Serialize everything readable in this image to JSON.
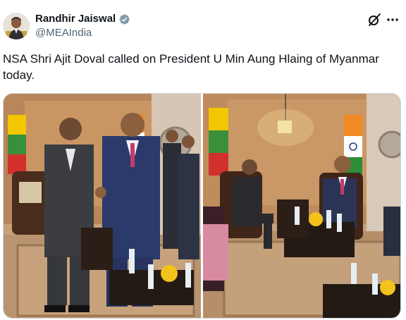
{
  "post": {
    "author": {
      "display_name": "Randhir Jaiswal",
      "handle": "@MEAIndia",
      "verified_icon": "verified-badge-icon",
      "avatar": "avatar"
    },
    "text": "NSA Shri Ajit Doval called on President U Min Aung Hlaing of Myanmar today.",
    "actions": {
      "grok_icon": "grok-icon",
      "more_icon": "more-options-icon"
    },
    "media": [
      {
        "name": "photo-handshake"
      },
      {
        "name": "photo-meeting"
      }
    ]
  },
  "colors": {
    "text": "#0f1419",
    "secondary": "#536471",
    "verified": "#829aab",
    "border": "#cfd9de"
  }
}
